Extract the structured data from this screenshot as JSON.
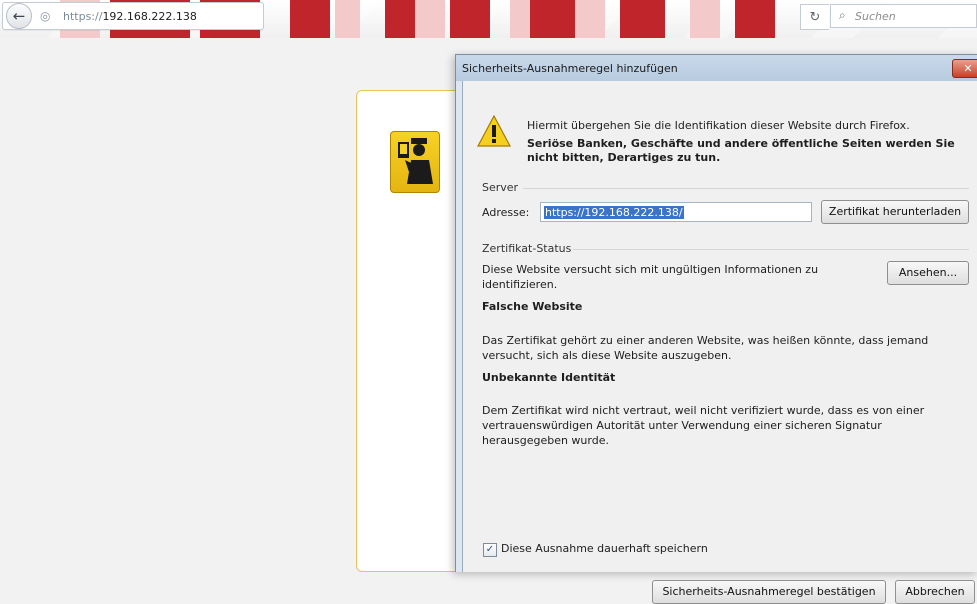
{
  "browser": {
    "url_protocol": "https://",
    "url_host": "192.168.222.138",
    "search_placeholder": "Suchen"
  },
  "dialog": {
    "title": "Sicherheits-Ausnahmeregel hinzufügen",
    "close_label": "✕",
    "intro_line1": "Hiermit übergehen Sie die Identifikation dieser Website durch Firefox.",
    "intro_line2": "Seriöse Banken, Geschäfte und andere öffentliche Seiten werden Sie nicht bitten, Derartiges zu tun.",
    "server": {
      "group_label": "Server",
      "address_label": "Adresse:",
      "address_value": "https://192.168.222.138/",
      "download_button": "Zertifikat herunterladen"
    },
    "certificate_status": {
      "group_label": "Zertifikat-Status",
      "status_text": "Diese Website versucht sich mit ungültigen Informationen zu identifizieren.",
      "view_button": "Ansehen...",
      "sections": [
        {
          "title": "Falsche Website",
          "description": "Das Zertifikat gehört zu einer anderen Website, was heißen könnte, dass jemand versucht, sich als diese Website auszugeben."
        },
        {
          "title": "Unbekannte Identität",
          "description": "Dem Zertifikat wird nicht vertraut, weil nicht verifiziert wurde, dass es von einer vertrauenswürdigen Autorität unter Verwendung einer sicheren Signatur herausgegeben wurde."
        }
      ]
    },
    "permanent_checkbox": {
      "label": "Diese Ausnahme dauerhaft speichern",
      "checked": true
    },
    "confirm_button": "Sicherheits-Ausnahmeregel bestätigen",
    "cancel_button": "Abbrechen"
  },
  "icons": {
    "back": "back-arrow-icon",
    "site": "site-identity-icon",
    "reload": "reload-icon",
    "search": "search-icon",
    "warning": "warning-icon",
    "officer": "security-officer-icon"
  },
  "colors": {
    "toolbar_stripe": "#c0252b",
    "dialog_frame": "#dce7f2",
    "selection": "#3a73c8",
    "warning_yellow": "#f6d225"
  }
}
